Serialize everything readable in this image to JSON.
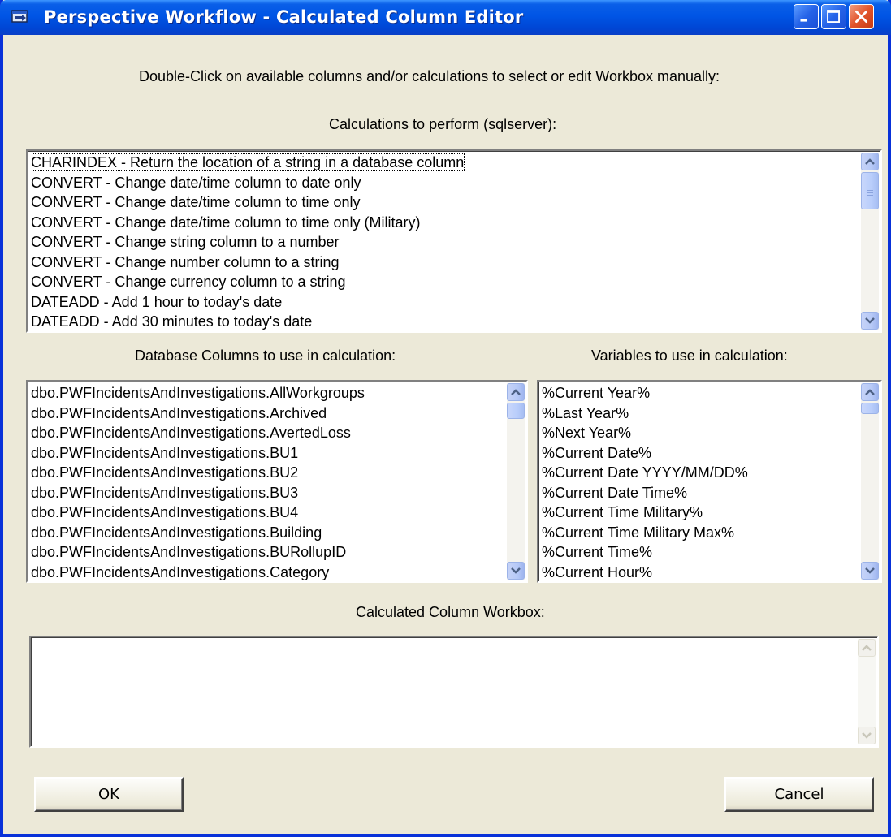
{
  "window": {
    "title": "Perspective Workflow - Calculated Column Editor"
  },
  "instructions": "Double-Click on available columns and/or calculations to select or edit Workbox manually:",
  "calculations": {
    "label": "Calculations to perform (sqlserver):",
    "items": [
      "CHARINDEX - Return the location of a string in a database column",
      "CONVERT - Change date/time column to date only",
      "CONVERT - Change date/time column to time only",
      "CONVERT - Change date/time column to time only (Military)",
      "CONVERT - Change string column to a number",
      "CONVERT - Change number column to a string",
      "CONVERT - Change currency column to a string",
      "DATEADD - Add 1 hour to today's date",
      "DATEADD - Add 30 minutes to today's date"
    ],
    "selected_index": 0
  },
  "columns": {
    "label": "Database Columns to use in calculation:",
    "items": [
      "dbo.PWFIncidentsAndInvestigations.AllWorkgroups",
      "dbo.PWFIncidentsAndInvestigations.Archived",
      "dbo.PWFIncidentsAndInvestigations.AvertedLoss",
      "dbo.PWFIncidentsAndInvestigations.BU1",
      "dbo.PWFIncidentsAndInvestigations.BU2",
      "dbo.PWFIncidentsAndInvestigations.BU3",
      "dbo.PWFIncidentsAndInvestigations.BU4",
      "dbo.PWFIncidentsAndInvestigations.Building",
      "dbo.PWFIncidentsAndInvestigations.BURollupID",
      "dbo.PWFIncidentsAndInvestigations.Category"
    ]
  },
  "variables": {
    "label": "Variables to use in calculation:",
    "items": [
      "%Current Year%",
      "%Last Year%",
      "%Next Year%",
      "%Current Date%",
      "%Current Date YYYY/MM/DD%",
      "%Current Date Time%",
      "%Current Time Military%",
      "%Current Time Military Max%",
      "%Current Time%",
      "%Current Hour%"
    ]
  },
  "workbox": {
    "label": "Calculated Column Workbox:",
    "value": ""
  },
  "buttons": {
    "ok": "OK",
    "cancel": "Cancel"
  },
  "colors": {
    "titlebar": "#0055e5",
    "window_bg": "#ece9d8",
    "close_button": "#e2542b"
  }
}
